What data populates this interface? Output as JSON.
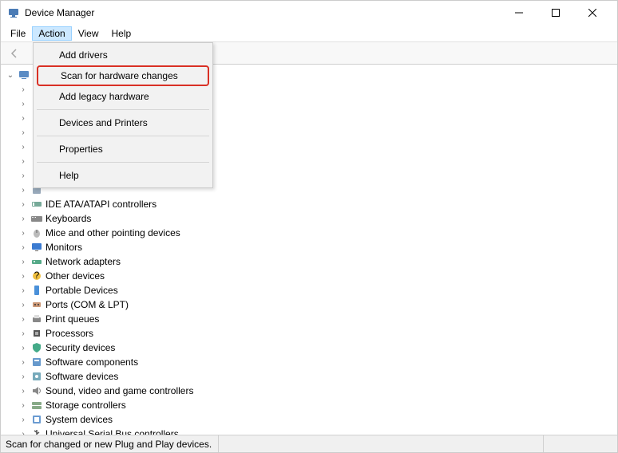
{
  "window": {
    "title": "Device Manager"
  },
  "menubar": {
    "items": [
      "File",
      "Action",
      "View",
      "Help"
    ],
    "active_index": 1
  },
  "action_menu": {
    "items": [
      {
        "label": "Add drivers",
        "highlight": false
      },
      {
        "label": "Scan for hardware changes",
        "highlight": true
      },
      {
        "label": "Add legacy hardware",
        "highlight": false
      },
      {
        "sep": true
      },
      {
        "label": "Devices and Printers",
        "highlight": false
      },
      {
        "sep": true
      },
      {
        "label": "Properties",
        "highlight": false
      },
      {
        "sep": true
      },
      {
        "label": "Help",
        "highlight": false
      }
    ]
  },
  "tree": {
    "root": {
      "label": "",
      "expanded": true
    },
    "categories": [
      {
        "label": "",
        "icon": "audio"
      },
      {
        "label": "",
        "icon": "bluetooth"
      },
      {
        "label": "",
        "icon": "camera"
      },
      {
        "label": "",
        "icon": "computer"
      },
      {
        "label": "",
        "icon": "disk"
      },
      {
        "label": "",
        "icon": "display"
      },
      {
        "label": "",
        "icon": "firmware"
      },
      {
        "label": "",
        "icon": "hid"
      },
      {
        "label": "IDE ATA/ATAPI controllers",
        "icon": "ide"
      },
      {
        "label": "Keyboards",
        "icon": "keyboard"
      },
      {
        "label": "Mice and other pointing devices",
        "icon": "mouse"
      },
      {
        "label": "Monitors",
        "icon": "monitor"
      },
      {
        "label": "Network adapters",
        "icon": "network"
      },
      {
        "label": "Other devices",
        "icon": "other"
      },
      {
        "label": "Portable Devices",
        "icon": "portable"
      },
      {
        "label": "Ports (COM & LPT)",
        "icon": "port"
      },
      {
        "label": "Print queues",
        "icon": "printer"
      },
      {
        "label": "Processors",
        "icon": "cpu"
      },
      {
        "label": "Security devices",
        "icon": "security"
      },
      {
        "label": "Software components",
        "icon": "swcomp"
      },
      {
        "label": "Software devices",
        "icon": "swdev"
      },
      {
        "label": "Sound, video and game controllers",
        "icon": "sound"
      },
      {
        "label": "Storage controllers",
        "icon": "storage"
      },
      {
        "label": "System devices",
        "icon": "system"
      },
      {
        "label": "Universal Serial Bus controllers",
        "icon": "usb"
      }
    ]
  },
  "statusbar": {
    "text": "Scan for changed or new Plug and Play devices."
  }
}
